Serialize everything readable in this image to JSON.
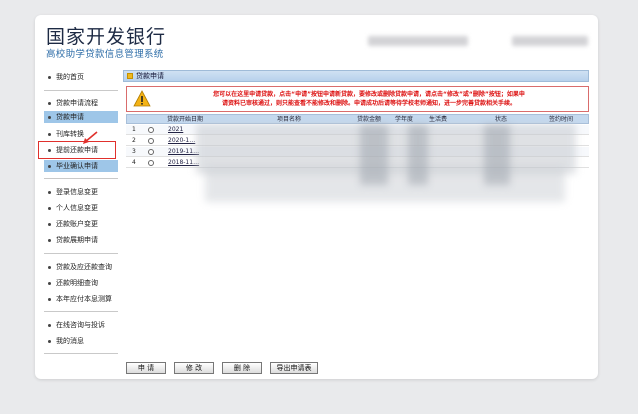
{
  "header": {
    "title": "国家开发银行",
    "subtitle": "高校助学贷款信息管理系统"
  },
  "sidebar": {
    "groups": [
      {
        "items": [
          {
            "label": "我的首页"
          }
        ]
      },
      {
        "items": [
          {
            "label": "贷款申请流程"
          },
          {
            "label": "贷款申请",
            "active": true
          },
          {
            "label": "刊库转换"
          },
          {
            "label": "提前还款申请"
          },
          {
            "label": "毕业确认申请"
          }
        ]
      },
      {
        "items": [
          {
            "label": "登录信息变更"
          },
          {
            "label": "个人信息变更"
          },
          {
            "label": "还款账户变更"
          },
          {
            "label": "贷款展期申请"
          }
        ]
      },
      {
        "items": [
          {
            "label": "贷款及应还款查询"
          },
          {
            "label": "还款明细查询"
          },
          {
            "label": "本年应付本息测算"
          }
        ]
      },
      {
        "items": [
          {
            "label": "在线咨询与投诉"
          },
          {
            "label": "我的消息"
          }
        ]
      }
    ]
  },
  "panel": {
    "title": "贷款申请",
    "notice_line1": "您可以在这里申请贷款，点击“申请”按钮申请新贷款，要修改或删除贷款申请，请点击“修改”或“删除”按钮；如果申",
    "notice_line2": "请资料已审核通过，则只能查看不能修改和删除。申请成功后请等待学校老师通知，进一步完善贷款相关手续。"
  },
  "table": {
    "headers": [
      "贷款开始日期",
      "项目名称",
      "贷款金额",
      "学年度",
      "生活费",
      "状态",
      "签约时间"
    ],
    "rows": [
      {
        "num": "1",
        "date": "2021"
      },
      {
        "num": "2",
        "date": "2020-1…"
      },
      {
        "num": "3",
        "date": "2019-11…"
      },
      {
        "num": "4",
        "date": "2018-11…"
      }
    ]
  },
  "buttons": {
    "apply": "申 请",
    "edit": "修 改",
    "delete": "删 除",
    "export": "导出申请表"
  },
  "colors": {
    "accent_blue": "#2f6ea8",
    "highlight_red": "#e0302c",
    "notice_red": "#dd1111",
    "active_item": "#9ec6e8"
  }
}
